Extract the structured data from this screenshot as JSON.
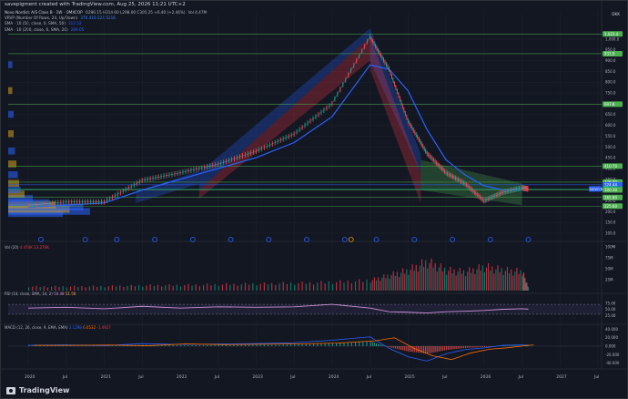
{
  "caption": "savepigment created with TradingView.com, Aug 25, 2026 11:21 UTC+2",
  "header": {
    "symbol_line": "Novo Nordisk A/S Class B · 1W · OMXCOP",
    "ohlc": "O296.15 H314.60 L298.00 C305.25 +6.40 (+2.46%)",
    "extra": "Vol 4.47M",
    "vrvp": "VRVP (Number Of Rows, 24, Up/Down)",
    "vrvp_vals": "370.410   224.5216",
    "sma50": "SMA · 10 (50, close, 0, SMA, 50)",
    "sma50_val": "312.52",
    "sma200": "SMA · 10 (200, close, 0, SMA, 20)",
    "sma200_val": "289.05"
  },
  "currency": "DKK",
  "price_axis": {
    "ticks": [
      "1,000.0",
      "950.0",
      "900.0",
      "850.0",
      "800.0",
      "750.0",
      "700.0",
      "650.0",
      "600.0",
      "550.0",
      "500.0",
      "450.0",
      "400.0",
      "350.0",
      "300.0",
      "250.0",
      "200.0",
      "150.0",
      "100.0"
    ]
  },
  "price_badges": [
    {
      "text": "1,023.4",
      "value": 1023.4,
      "color": "#4caf50"
    },
    {
      "text": "931.9",
      "value": 931.9,
      "color": "#4caf50"
    },
    {
      "text": "697.8",
      "value": 697.8,
      "color": "#4caf50"
    },
    {
      "text": "410.70",
      "value": 410.7,
      "color": "#4caf50"
    },
    {
      "text": "336.80",
      "value": 336.8,
      "color": "#4caf50"
    },
    {
      "text": "324.44",
      "value": 324.44,
      "color": "#2962ff"
    },
    {
      "text": "305.25",
      "value": 305.25,
      "color": "#089981"
    },
    {
      "text": "300.30",
      "value": 300.3,
      "color": "#4caf50"
    },
    {
      "text": "265.80",
      "value": 265.8,
      "color": "#4caf50"
    },
    {
      "text": "225.60",
      "value": 225.6,
      "color": "#4caf50"
    }
  ],
  "symbol_badge": "NOVO B",
  "volume_pane": {
    "label": "Vol (20)",
    "value1": "4.474K",
    "value2": "23.276K",
    "ticks": [
      "100M",
      "75M",
      "50M",
      "25M"
    ]
  },
  "rsi_pane": {
    "label": "RSI (14, close, SMA, 14, 2)",
    "value1": "50.48",
    "value2": "51.50",
    "ticks": [
      "75.00",
      "50.00",
      "25.00"
    ]
  },
  "macd_pane": {
    "label": "MACD (12, 26, close, 9, EMA, EMA)",
    "value1": "2.1298",
    "value2": "6.6532",
    "value3": "-1.4927",
    "ticks": [
      "40.000",
      "20.000",
      "0.000",
      "-20.000",
      "-40.000"
    ]
  },
  "time_axis": [
    "2020",
    "Jul",
    "2021",
    "Jul",
    "2022",
    "Jul",
    "2023",
    "Jul",
    "2024",
    "Jul",
    "2025",
    "Jul",
    "2026",
    "Jul",
    "2027",
    "Jul"
  ],
  "brand": "TradingView",
  "chart_data": {
    "type": "line",
    "title": "Novo Nordisk A/S Class B · 1W · OMXCOP",
    "ylabel": "DKK",
    "ylim": [
      100,
      1050
    ],
    "x": [
      "2020-01",
      "2020-07",
      "2021-01",
      "2021-07",
      "2022-01",
      "2022-07",
      "2023-01",
      "2023-07",
      "2024-01",
      "2024-07",
      "2024-10",
      "2025-01",
      "2025-04",
      "2025-07",
      "2025-10",
      "2026-01",
      "2026-04",
      "2026-07",
      "2026-08"
    ],
    "series": [
      {
        "name": "Close",
        "values": [
          230,
          245,
          245,
          345,
          380,
          420,
          480,
          560,
          700,
          1010,
          860,
          620,
          470,
          380,
          330,
          250,
          290,
          310,
          305.25
        ]
      },
      {
        "name": "SMA 50",
        "values": [
          220,
          230,
          240,
          300,
          350,
          400,
          450,
          520,
          640,
          880,
          860,
          760,
          580,
          440,
          370,
          320,
          300,
          300,
          312.52
        ]
      }
    ],
    "volume": {
      "name": "Vol",
      "unit": "M",
      "values": [
        12,
        12,
        13,
        15,
        16,
        18,
        20,
        22,
        25,
        30,
        45,
        60,
        85,
        60,
        55,
        70,
        60,
        55,
        4.47
      ]
    },
    "rsi": {
      "name": "RSI",
      "values": [
        55,
        58,
        52,
        62,
        55,
        60,
        58,
        60,
        70,
        55,
        40,
        38,
        35,
        40,
        42,
        45,
        50,
        52,
        50.48
      ]
    },
    "macd": {
      "name": "MACD",
      "values": [
        2,
        3,
        1,
        6,
        4,
        5,
        6,
        8,
        14,
        22,
        -5,
        -25,
        -35,
        -18,
        -8,
        -4,
        2,
        3,
        2.13
      ]
    },
    "annotations": [
      {
        "text": "1,023.4",
        "value": 1023.4
      },
      {
        "text": "931.9",
        "value": 931.9
      },
      {
        "text": "697.8",
        "value": 697.8
      },
      {
        "text": "410.70",
        "value": 410.7
      },
      {
        "text": "336.80",
        "value": 336.8
      },
      {
        "text": "300.30",
        "value": 300.3
      },
      {
        "text": "265.80",
        "value": 265.8
      },
      {
        "text": "225.60",
        "value": 225.6
      }
    ]
  }
}
